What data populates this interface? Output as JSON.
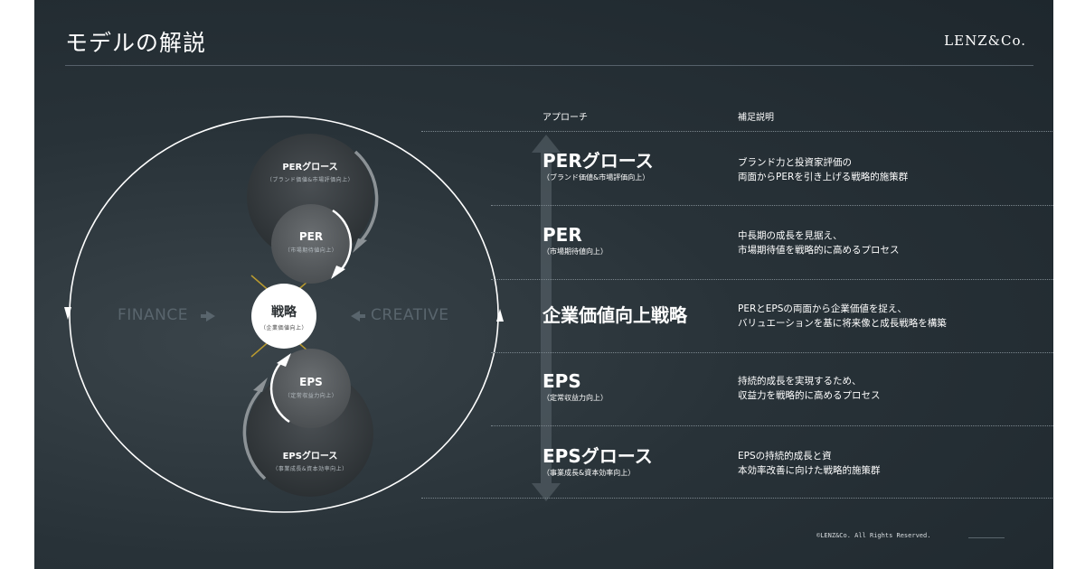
{
  "header": {
    "title": "モデルの解説",
    "brand": "LENZ&Co."
  },
  "diagram": {
    "finance_label": "FINANCE",
    "creative_label": "CREATIVE",
    "circles": {
      "per_growth": {
        "main": "PERグロース",
        "sub": "（ブランド価値&市場評価向上）"
      },
      "per": {
        "main": "PER",
        "sub": "（市場期待値向上）"
      },
      "center": {
        "main": "戦略",
        "sub": "（企業価値向上）"
      },
      "eps": {
        "main": "EPS",
        "sub": "（定常収益力向上）"
      },
      "eps_growth": {
        "main": "EPSグロース",
        "sub": "（事業成長&資本効率向上）"
      }
    }
  },
  "table": {
    "col_approach": "アプローチ",
    "col_note": "補足説明",
    "rows": [
      {
        "main": "PERグロース",
        "sub": "（ブランド価値&市場評価向上）",
        "desc1": "ブランド力と投資家評価の",
        "desc2": "両面からPERを引き上げる戦略的施策群"
      },
      {
        "main": "PER",
        "sub": "（市場期待値向上）",
        "desc1": "中長期の成長を見据え、",
        "desc2": "市場期待値を戦略的に高めるプロセス"
      },
      {
        "main": "企業価値向上戦略",
        "sub": "",
        "desc1": "PERとEPSの両面から企業価値を捉え、",
        "desc2": "バリュエーションを基に将来像と成長戦略を構築"
      },
      {
        "main": "EPS",
        "sub": "（定常収益力向上）",
        "desc1": "持続的成長を実現するため、",
        "desc2": "収益力を戦略的に高めるプロセス"
      },
      {
        "main": "EPSグロース",
        "sub": "（事業成長&資本効率向上）",
        "desc1": "EPSの持続的成長と資",
        "desc2": "本効率改善に向けた戦略的施策群"
      }
    ]
  },
  "footer": {
    "copyright": "©LENZ&Co. All Rights Reserved."
  }
}
